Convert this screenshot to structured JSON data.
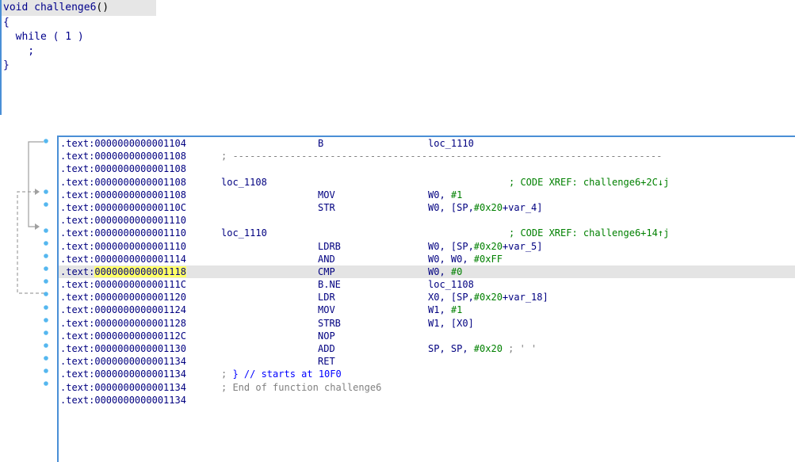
{
  "pseudocode": {
    "signature": "void challenge6",
    "parens": "()",
    "lines": [
      "{",
      "  while ( 1 )",
      "    ;",
      "}"
    ]
  },
  "disassembly": {
    "selected_row": 13,
    "rows": [
      {
        "addr": ".text:0000000000001104",
        "mnem": "B",
        "ops": "loc_1110"
      },
      {
        "addr": ".text:0000000000001108",
        "separator": "; ---------------------------------------------------------------------------"
      },
      {
        "addr": ".text:0000000000001108"
      },
      {
        "addr": ".text:0000000000001108",
        "label": "loc_1108",
        "xref": "; CODE XREF: challenge6+2C↓j"
      },
      {
        "addr": ".text:0000000000001108",
        "mnem": "MOV",
        "ops": "W0, #1"
      },
      {
        "addr": ".text:000000000000110C",
        "mnem": "STR",
        "ops": "W0, [SP,#0x20+var_4]"
      },
      {
        "addr": ".text:0000000000001110"
      },
      {
        "addr": ".text:0000000000001110",
        "label": "loc_1110",
        "xref": "; CODE XREF: challenge6+14↑j"
      },
      {
        "addr": ".text:0000000000001110",
        "mnem": "LDRB",
        "ops": "W0, [SP,#0x20+var_5]"
      },
      {
        "addr": ".text:0000000000001114",
        "mnem": "AND",
        "ops": "W0, W0, #0xFF"
      },
      {
        "addr": ".text:0000000000001118",
        "mnem": "CMP",
        "ops": "W0, #0"
      },
      {
        "addr": ".text:000000000000111C",
        "mnem": "B.NE",
        "ops": "loc_1108"
      },
      {
        "addr": ".text:0000000000001120",
        "mnem": "LDR",
        "ops": "X0, [SP,#0x20+var_18]"
      },
      {
        "addr": ".text:0000000000001124",
        "mnem": "MOV",
        "ops": "W1, #1"
      },
      {
        "addr": ".text:0000000000001128",
        "mnem": "STRB",
        "ops": "W1, [X0]"
      },
      {
        "addr": ".text:000000000000112C",
        "mnem": "NOP",
        "ops": ""
      },
      {
        "addr": ".text:0000000000001130",
        "mnem": "ADD",
        "ops": "SP, SP, #0x20 ; ' '"
      },
      {
        "addr": ".text:0000000000001134",
        "mnem": "RET",
        "ops": ""
      },
      {
        "addr": ".text:0000000000001134",
        "comment_pre": "; ",
        "comment_blue": "} // starts at 10F0"
      },
      {
        "addr": ".text:0000000000001134",
        "comment": "; End of function challenge6"
      },
      {
        "addr": ".text:0000000000001134"
      }
    ]
  },
  "colors": {
    "accent_border": "#4a8fd6",
    "selection_bg": "#e4e4e4",
    "highlight": "#ffff66",
    "xref_green": "#008000",
    "breakpoint_dot": "#55b7ef"
  }
}
